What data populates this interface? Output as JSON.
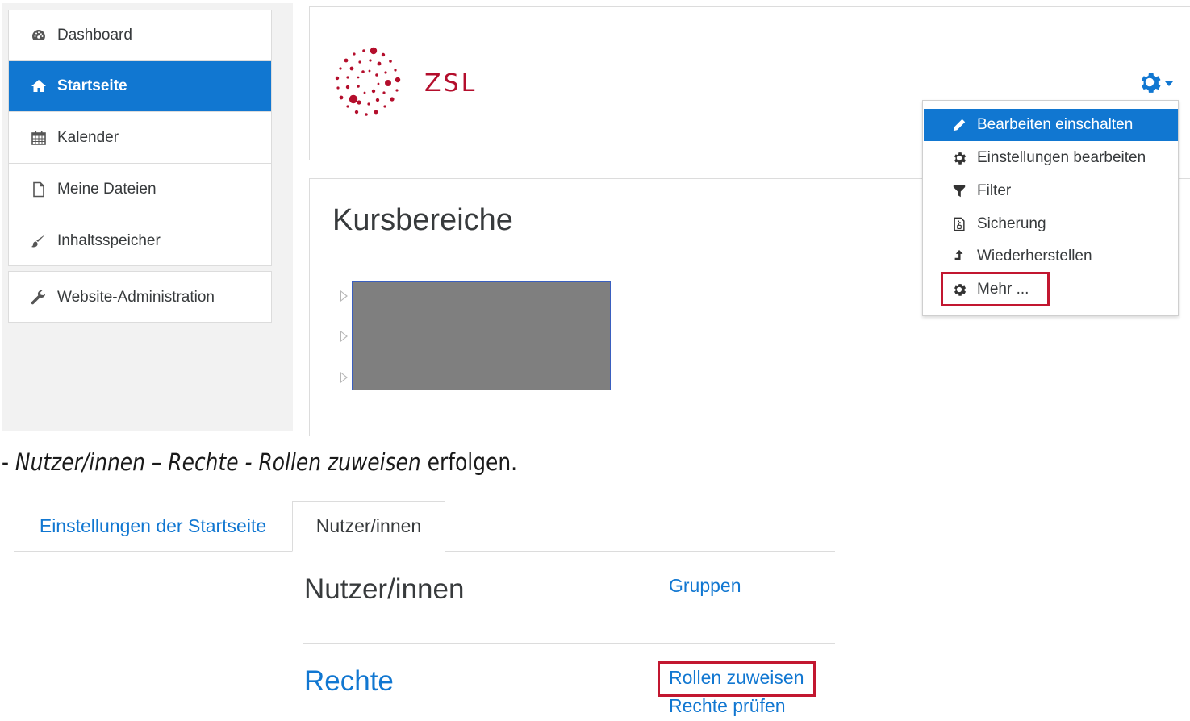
{
  "nav": {
    "items": [
      {
        "label": "Dashboard",
        "icon": "dashboard-icon"
      },
      {
        "label": "Startseite",
        "icon": "home-icon",
        "active": true
      },
      {
        "label": "Kalender",
        "icon": "calendar-icon"
      },
      {
        "label": "Meine Dateien",
        "icon": "file-icon"
      },
      {
        "label": "Inhaltsspeicher",
        "icon": "paintbrush-icon"
      }
    ],
    "admin": {
      "label": "Website-Administration",
      "icon": "wrench-icon"
    }
  },
  "header": {
    "logo_text": "ZSL"
  },
  "main": {
    "section_title": "Kursbereiche"
  },
  "menu": {
    "items": [
      {
        "label": "Bearbeiten einschalten",
        "icon": "pencil-icon",
        "active": true
      },
      {
        "label": "Einstellungen bearbeiten",
        "icon": "gear-icon"
      },
      {
        "label": "Filter",
        "icon": "filter-icon"
      },
      {
        "label": "Sicherung",
        "icon": "backup-file-icon"
      },
      {
        "label": "Wiederherstellen",
        "icon": "restore-arrow-icon"
      },
      {
        "label": "Mehr ...",
        "icon": "gear-icon",
        "highlighted": true
      }
    ]
  },
  "instruction": {
    "prefix": "- ",
    "italic": "Nutzer/innen – Rechte - Rollen zuweisen",
    "suffix": " erfolgen."
  },
  "admin_page": {
    "tabs": [
      {
        "label": "Einstellungen der Startseite",
        "active": false
      },
      {
        "label": "Nutzer/innen",
        "active": true
      }
    ],
    "users_heading": "Nutzer/innen",
    "groups_link": "Gruppen",
    "rights_heading": "Rechte",
    "assign_roles_link": "Rollen zuweisen",
    "check_rights_link": "Rechte prüfen"
  },
  "colors": {
    "primary": "#1177d1",
    "brand_red": "#b40e2c",
    "highlight_red": "#c21730",
    "text": "#373a3c"
  }
}
